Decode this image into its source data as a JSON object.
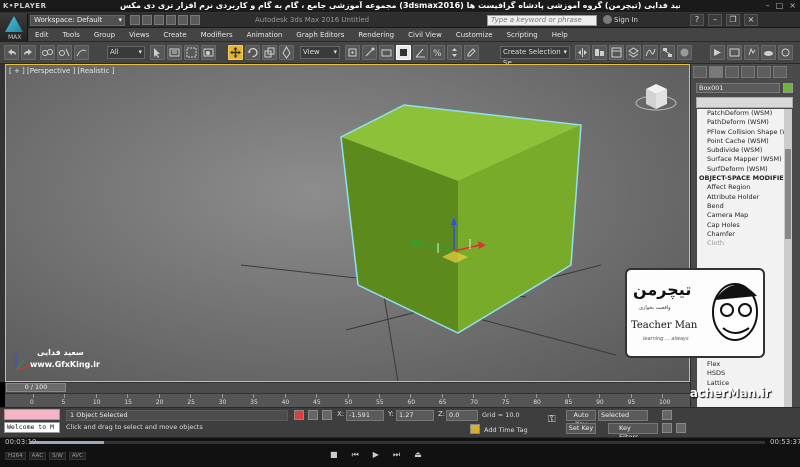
{
  "player": {
    "logo": "K•PLAYER",
    "title": "مجموعه آموزشی جامع ، گام به گام و کاربردی نرم افزار تری دی مکس (3dsmax2016) مدرس : سعید فدایی (تیچرمن) گروه آموزشی پادشاه گرافیست ها",
    "time_elapsed": "00:03:10",
    "time_total": "00:53:37",
    "progress": 0.1,
    "info_tags": [
      "H264",
      "AAC",
      "S/W",
      "AVC"
    ]
  },
  "max": {
    "logo_text": "MAX",
    "workspace": "Workspace: Default",
    "doc_title": "Autodesk 3ds Max 2016    Untitled",
    "search_placeholder": "Type a keyword or phrase",
    "sign_in": "Sign In"
  },
  "menu": [
    "Edit",
    "Tools",
    "Group",
    "Views",
    "Create",
    "Modifiers",
    "Animation",
    "Graph Editors",
    "Rendering",
    "Civil View",
    "Customize",
    "Scripting",
    "Help"
  ],
  "toolbar": {
    "filter_select": "All",
    "ref_coord": "View",
    "named_sel": "Create Selection Se"
  },
  "viewport": {
    "label": "[ + ] [Perspective ] [Realistic ]",
    "object_color": "#7fb52e",
    "selection_color": "#8fe0f0"
  },
  "command_panel": {
    "object_name": "Box001",
    "object_color": "#6db43a",
    "modifiers": [
      {
        "label": "PatchDeform (WSM)",
        "type": "item"
      },
      {
        "label": "PathDeform (WSM)",
        "type": "item"
      },
      {
        "label": "PFlow Collision Shape (WSM)",
        "type": "item"
      },
      {
        "label": "Point Cache (WSM)",
        "type": "item"
      },
      {
        "label": "Subdivide (WSM)",
        "type": "item"
      },
      {
        "label": "Surface Mapper (WSM)",
        "type": "item"
      },
      {
        "label": "SurfDeform (WSM)",
        "type": "item"
      },
      {
        "label": "OBJECT-SPACE MODIFIERS",
        "type": "hdr"
      },
      {
        "label": "Affect Region",
        "type": "item"
      },
      {
        "label": "Attribute Holder",
        "type": "item"
      },
      {
        "label": "Bend",
        "type": "item"
      },
      {
        "label": "Camera Map",
        "type": "item"
      },
      {
        "label": "Cap Holes",
        "type": "item"
      },
      {
        "label": "Chamfer",
        "type": "item"
      },
      {
        "label": "Cloth",
        "type": "grey"
      },
      {
        "label": "",
        "type": "item"
      },
      {
        "label": "",
        "type": "item"
      },
      {
        "label": "",
        "type": "item"
      },
      {
        "label": "",
        "type": "item"
      },
      {
        "label": "",
        "type": "item"
      },
      {
        "label": "",
        "type": "item"
      },
      {
        "label": "",
        "type": "item"
      },
      {
        "label": "",
        "type": "item"
      },
      {
        "label": "",
        "type": "item"
      },
      {
        "label": "",
        "type": "item"
      },
      {
        "label": "",
        "type": "item"
      },
      {
        "label": "",
        "type": "item"
      },
      {
        "label": "Flex",
        "type": "item"
      },
      {
        "label": "HSDS",
        "type": "item"
      },
      {
        "label": "Lattice",
        "type": "item"
      }
    ]
  },
  "timeline": {
    "slider_label": "0 / 100",
    "ticks": [
      "0",
      "5",
      "10",
      "15",
      "20",
      "25",
      "30",
      "35",
      "40",
      "45",
      "50",
      "55",
      "60",
      "65",
      "70",
      "75",
      "80",
      "85",
      "90",
      "95",
      "100"
    ]
  },
  "status": {
    "listener_text": "Welcome to M",
    "selection_count": "1 Object Selected",
    "prompt": "Click and drag to select and move objects",
    "x_label": "X:",
    "x_value": "-1.591",
    "y_label": "Y:",
    "y_value": "1.27",
    "z_label": "Z:",
    "z_value": "0.0",
    "grid": "Grid = 10.0",
    "add_time_tag": "Add Time Tag",
    "auto_key": "Auto Key",
    "set_key": "Set Key",
    "key_mode": "Selected",
    "key_filters": "Key Filters..."
  },
  "watermark": {
    "url": "www.TeacherMan.ir",
    "card_fa": "تیچرمن",
    "card_sub": "واقعیت بخواری",
    "card_en": "Teacher Man",
    "card_en2": "learning ... always",
    "left_fa": "سعید فدایی",
    "left_en": "www.GfxKing.ir"
  }
}
